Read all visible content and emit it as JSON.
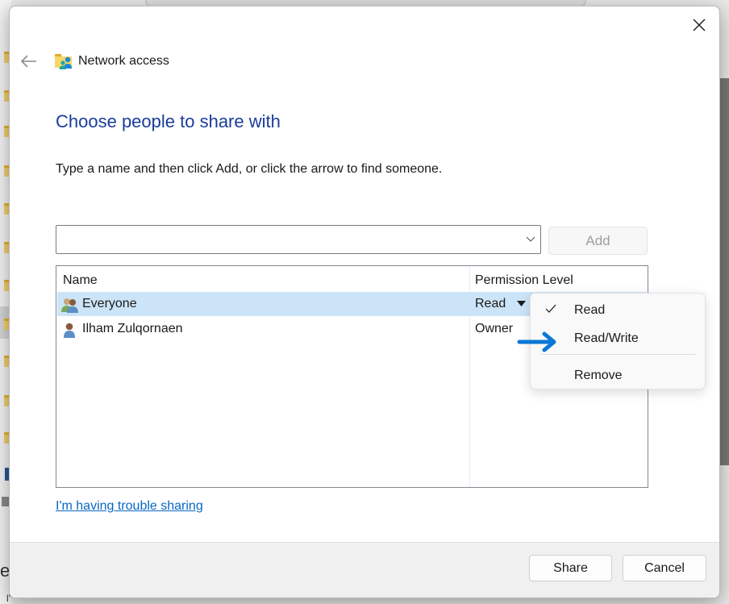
{
  "dialog": {
    "title": "Network access",
    "heading": "Choose people to share with",
    "instruction": "Type a name and then click Add, or click the arrow to find someone.",
    "name_input": {
      "value": "",
      "placeholder": ""
    },
    "add_label": "Add",
    "list": {
      "columns": [
        "Name",
        "Permission Level"
      ],
      "rows": [
        {
          "name": "Everyone",
          "permission": "Read",
          "icon": "group-users-icon",
          "selected": true
        },
        {
          "name": "Ilham Zulqornaen",
          "permission": "Owner",
          "icon": "user-icon",
          "selected": false
        }
      ]
    },
    "trouble_link": "I'm having trouble sharing",
    "share_label": "Share",
    "cancel_label": "Cancel"
  },
  "permission_menu": {
    "items": [
      {
        "label": "Read",
        "checked": true
      },
      {
        "label": "Read/Write",
        "checked": false
      },
      {
        "label": "Remove",
        "checked": false
      }
    ]
  },
  "colors": {
    "heading": "#1a3c9a",
    "link": "#0a66c2",
    "selection": "#cce4f7",
    "annotation_arrow": "#0a78d4"
  },
  "background": {
    "bottom_left_text": "e",
    "bottom_left_text2": "l”",
    "right_bracket": "]"
  }
}
